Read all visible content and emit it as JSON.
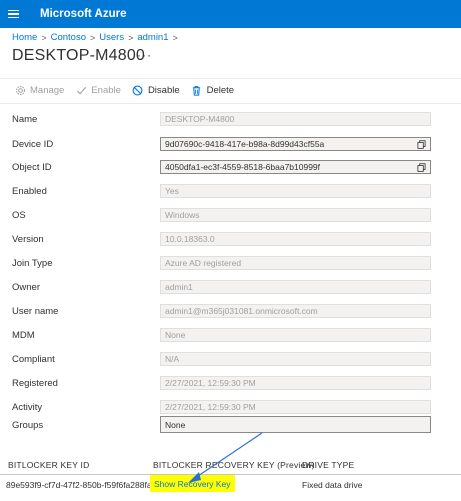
{
  "header": {
    "brand": "Microsoft Azure",
    "menu_icon": "hamburger-icon",
    "bg_color": "#0078d4"
  },
  "breadcrumb": [
    "Home",
    "Contoso",
    "Users",
    "admin1"
  ],
  "page": {
    "title": "DESKTOP-M4800",
    "more": "···"
  },
  "toolbar": {
    "manage": "Manage",
    "enable": "Enable",
    "disable": "Disable",
    "delete": "Delete"
  },
  "properties": [
    {
      "label": "Name",
      "value": "DESKTOP-M4800"
    },
    {
      "label": "Device ID",
      "value": "9d07690c-9418-417e-b98a-8d99d43cf55a"
    },
    {
      "label": "Object ID",
      "value": "4050dfa1-ec3f-4559-8518-6baa7b10999f"
    },
    {
      "label": "Enabled",
      "value": "Yes"
    },
    {
      "label": "OS",
      "value": "Windows"
    },
    {
      "label": "Version",
      "value": "10.0.18363.0"
    },
    {
      "label": "Join Type",
      "value": "Azure AD registered"
    },
    {
      "label": "Owner",
      "value": "admin1"
    },
    {
      "label": "User name",
      "value": "admin1@m365j031081.onmicrosoft.com"
    },
    {
      "label": "MDM",
      "value": "None"
    },
    {
      "label": "Compliant",
      "value": "N/A"
    },
    {
      "label": "Registered",
      "value": "2/27/2021, 12:59:30 PM"
    },
    {
      "label": "Activity",
      "value": "2/27/2021, 12:59:30 PM"
    },
    {
      "label": "Groups",
      "value": "None"
    }
  ],
  "bitlocker": {
    "headers": [
      "BITLOCKER KEY ID",
      "BITLOCKER RECOVERY KEY (Preview)",
      "DRIVE TYPE"
    ],
    "key_id": "89e593f9-cf7d-47f2-850b-f59f6fa288fa",
    "show_key_label": "Show Recovery Key",
    "drive_type": "Fixed data drive",
    "highlight_color": "#ffff00",
    "annotation_arrow_color": "#2b6fd6"
  }
}
